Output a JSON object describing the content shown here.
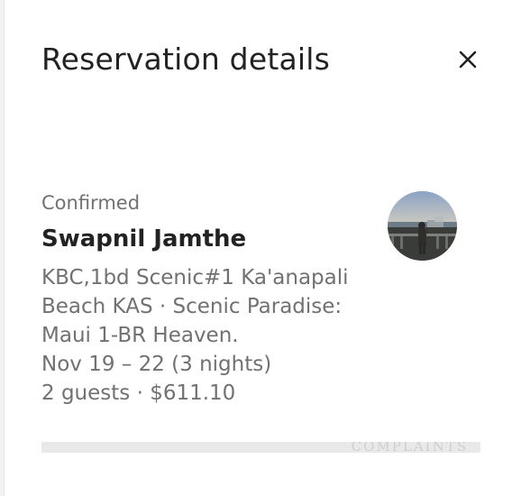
{
  "header": {
    "title": "Reservation details",
    "close_icon": "close-icon"
  },
  "reservation": {
    "status": "Confirmed",
    "guest_name": "Swapnil Jamthe",
    "listing_lines": [
      "KBC,1bd Scenic#1 Ka'anapali",
      "Beach KAS · Scenic Paradise:",
      "Maui 1-BR Heaven."
    ],
    "dates": "Nov 19 – 22 (3 nights)",
    "guests_and_price": "2 guests · $611.10"
  },
  "avatar": {
    "icon": "guest-avatar"
  },
  "footer": {
    "partial_text": "COMPLAINTS"
  },
  "colors": {
    "primary_text": "#222222",
    "secondary_text": "#717171"
  }
}
